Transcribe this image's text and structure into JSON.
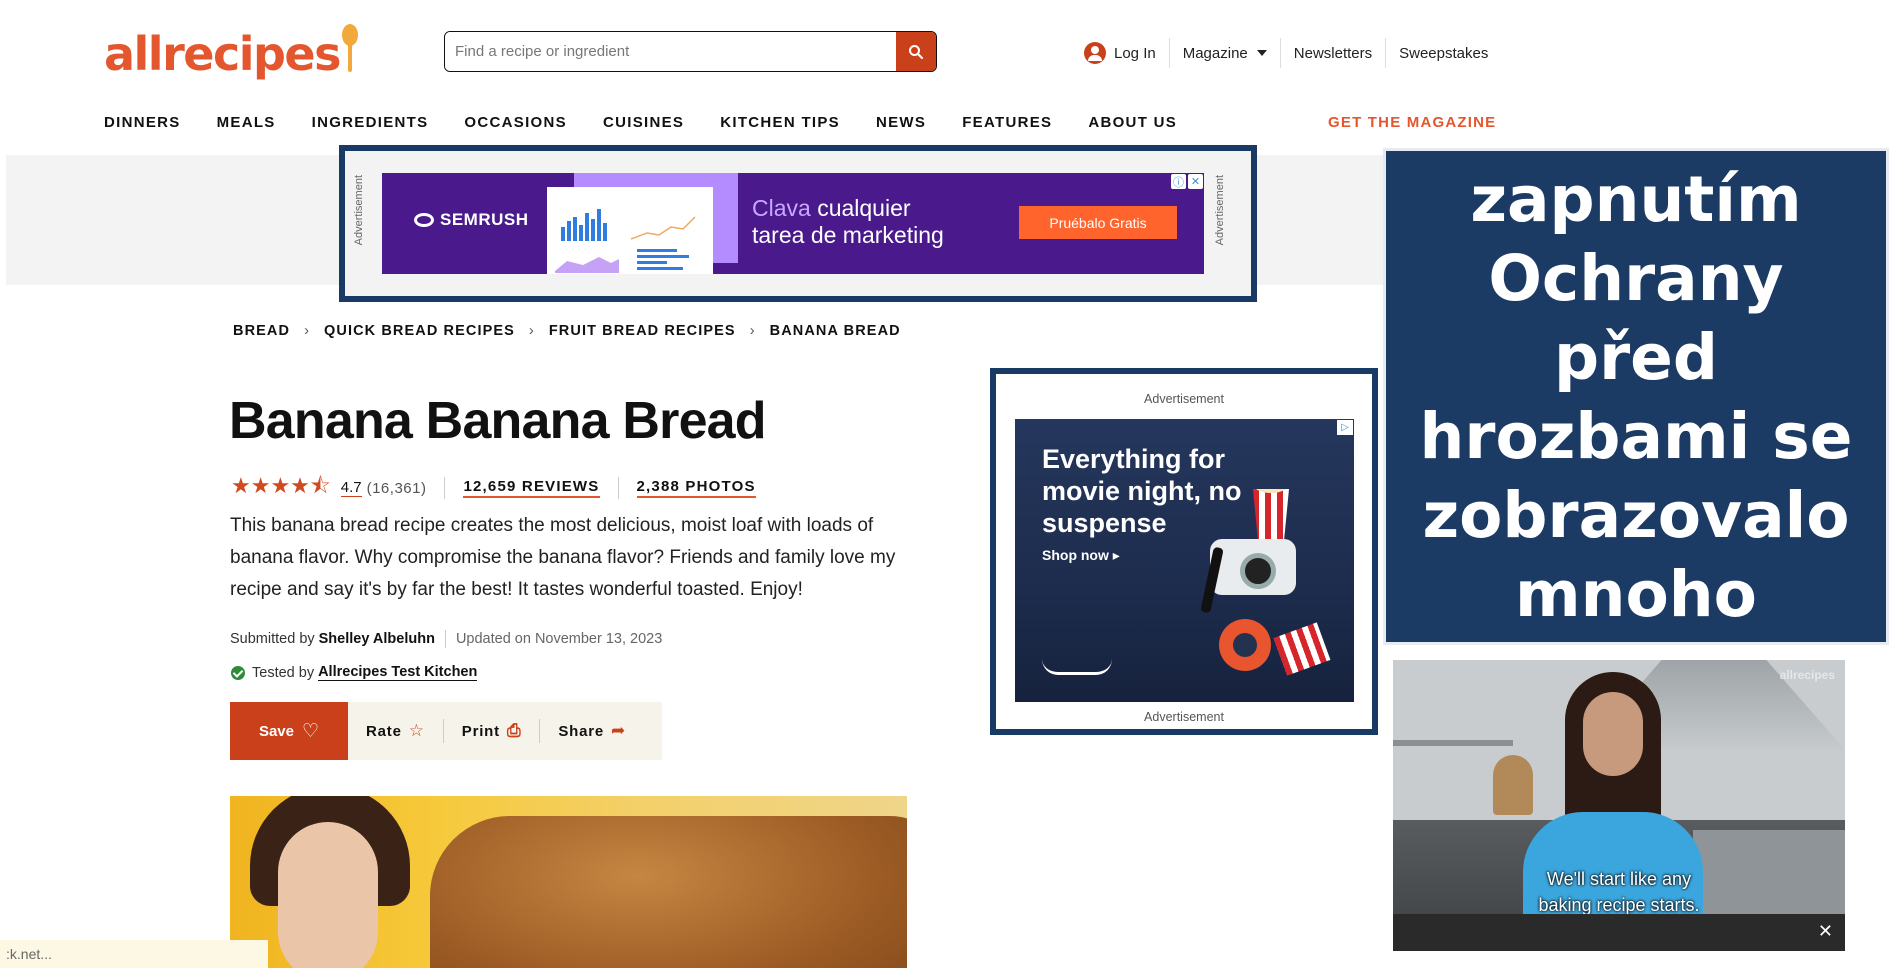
{
  "header": {
    "logo": "allrecipes",
    "search_placeholder": "Find a recipe or ingredient",
    "login": "Log In",
    "magazine": "Magazine",
    "newsletters": "Newsletters",
    "sweepstakes": "Sweepstakes",
    "nav": [
      "DINNERS",
      "MEALS",
      "INGREDIENTS",
      "OCCASIONS",
      "CUISINES",
      "KITCHEN TIPS",
      "NEWS",
      "FEATURES",
      "ABOUT US"
    ],
    "get_magazine": "GET THE MAGAZINE"
  },
  "top_ad": {
    "label": "Advertisement",
    "brand": "SEMRUSH",
    "headline_highlight": "Clava",
    "headline_rest": " cualquier",
    "headline_line2": "tarea de marketing",
    "cta": "Pruébalo Gratis"
  },
  "breadcrumb": [
    "BREAD",
    "QUICK BREAD RECIPES",
    "FRUIT BREAD RECIPES",
    "BANANA BREAD"
  ],
  "recipe": {
    "title": "Banana Banana Bread",
    "rating": "4.7",
    "rating_fraction": 0.94,
    "rating_count": "(16,361)",
    "reviews": "12,659 REVIEWS",
    "photos": "2,388 PHOTOS",
    "description": "This banana bread recipe creates the most delicious, moist loaf with loads of banana flavor. Why compromise the banana flavor? Friends and family love my recipe and say it's by far the best! It tastes wonderful toasted. Enjoy!",
    "submitted_by_label": "Submitted by",
    "author": "Shelley Albeluhn",
    "updated": "Updated on November 13, 2023",
    "tested_by_label": "Tested by",
    "tested_by": "Allrecipes Test Kitchen"
  },
  "actions": {
    "save": "Save",
    "rate": "Rate",
    "print": "Print",
    "share": "Share"
  },
  "right_ad": {
    "label_top": "Advertisement",
    "label_bottom": "Advertisement",
    "headline": "Everything for movie night, no suspense",
    "shop": "Shop now ▸"
  },
  "overlay": {
    "text_lines": [
      "Před zapnutím",
      "Ochrany před",
      "hrozbami se",
      "zobrazovalo",
      "mnoho reklam"
    ]
  },
  "video": {
    "watermark": "allrecipes",
    "caption_line1": "We'll start like any",
    "caption_line2": "baking recipe starts.",
    "close": "✕"
  },
  "statusbar": {
    "text": ":k.net..."
  },
  "colors": {
    "brand_orange": "#e4572e",
    "button_red": "#c9401b",
    "frame_navy": "#1a3a66",
    "overlay_navy": "#1b3a64"
  }
}
